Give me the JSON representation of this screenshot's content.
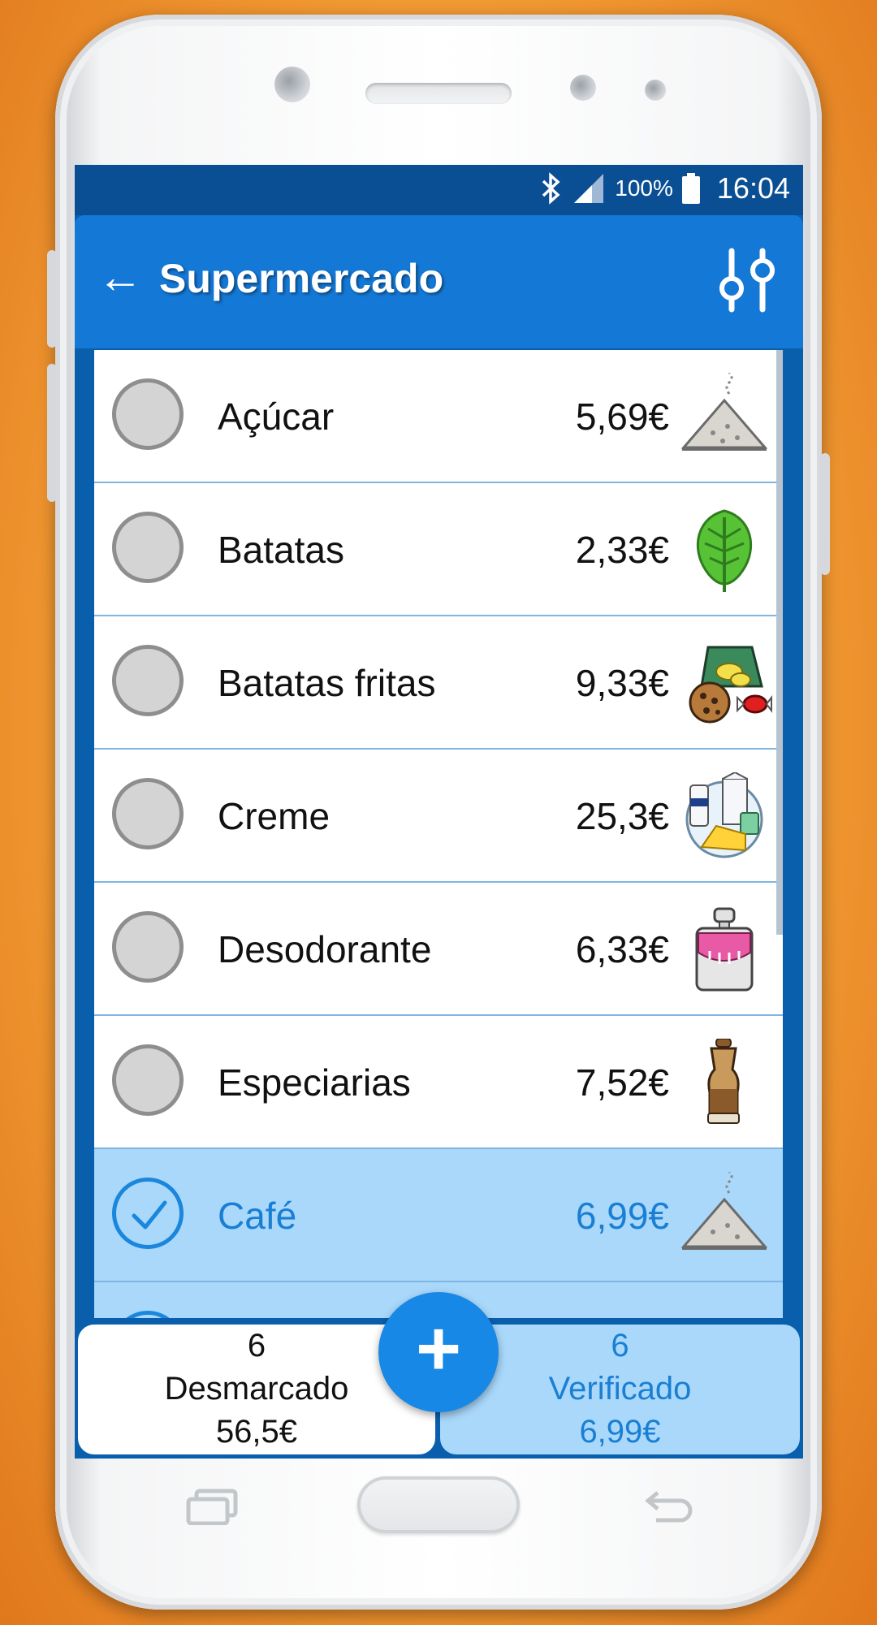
{
  "status_bar": {
    "battery": "100%",
    "time": "16:04",
    "icons": [
      "bluetooth-icon",
      "signal-icon",
      "battery-icon"
    ]
  },
  "app_bar": {
    "title": "Supermercado",
    "back_icon": "arrow-left-icon",
    "filter_icon": "sliders-icon"
  },
  "items": [
    {
      "name": "Açúcar",
      "price": "5,69€",
      "checked": false,
      "category_icon": "sugar-pile-icon"
    },
    {
      "name": "Batatas",
      "price": "2,33€",
      "checked": false,
      "category_icon": "leaf-icon"
    },
    {
      "name": "Batatas fritas",
      "price": "9,33€",
      "checked": false,
      "category_icon": "snacks-icon"
    },
    {
      "name": "Creme",
      "price": "25,3€",
      "checked": false,
      "category_icon": "dairy-icon"
    },
    {
      "name": "Desodorante",
      "price": "6,33€",
      "checked": false,
      "category_icon": "perfume-bottle-icon"
    },
    {
      "name": "Especiarias",
      "price": "7,52€",
      "checked": false,
      "category_icon": "spice-grinder-icon"
    },
    {
      "name": "Café",
      "price": "6,99€",
      "checked": true,
      "category_icon": "sugar-pile-icon"
    }
  ],
  "footer": {
    "unchecked": {
      "count": "6",
      "label": "Desmarcado",
      "total": "56,5€"
    },
    "checked": {
      "count": "6",
      "label": "Verificado",
      "total": "6,99€"
    },
    "add_label": "+"
  },
  "colors": {
    "primary": "#1478d6",
    "checked_bg": "#a9d8fb",
    "accent": "#1788e6",
    "background": "#f6a43a"
  }
}
